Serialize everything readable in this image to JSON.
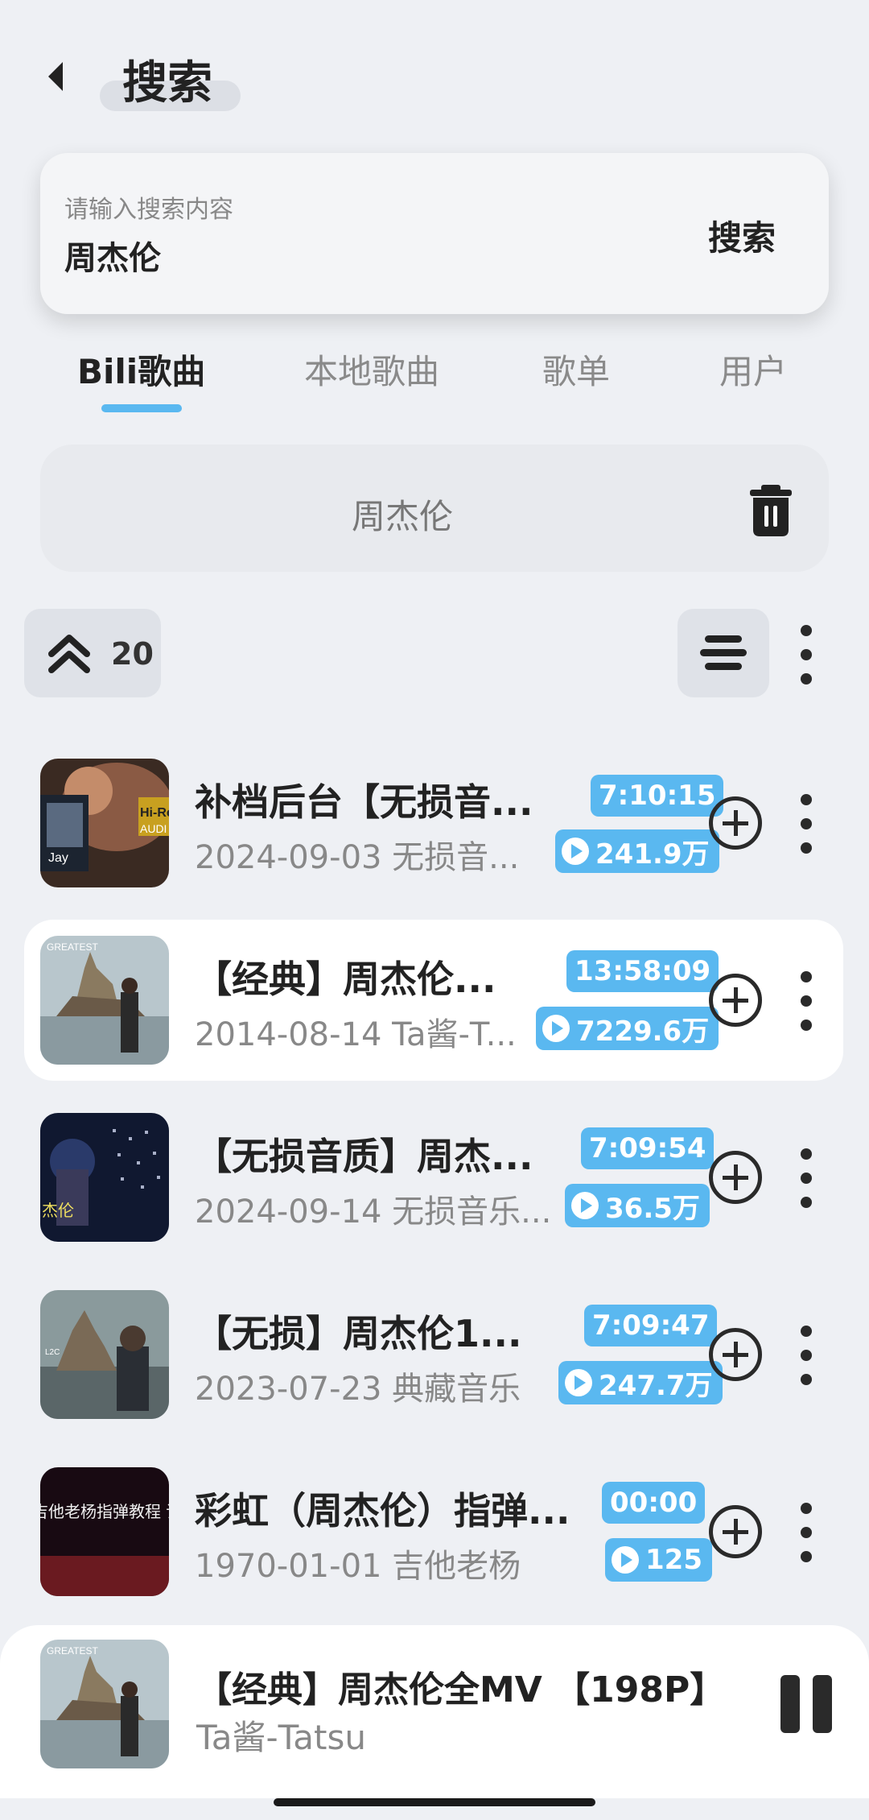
{
  "header": {
    "title": "搜索"
  },
  "search": {
    "placeholder": "请输入搜索内容",
    "value": "周杰伦",
    "button_label": "搜索"
  },
  "tabs": [
    {
      "label": "Bili歌曲",
      "active": true
    },
    {
      "label": "本地歌曲",
      "active": false
    },
    {
      "label": "歌单",
      "active": false
    },
    {
      "label": "用户",
      "active": false
    }
  ],
  "history": {
    "items": [
      "周杰伦"
    ]
  },
  "toolbar": {
    "count": "20"
  },
  "results": [
    {
      "title": "补档后台【无损音...",
      "subtitle": "2024-09-03 无损音...",
      "duration": "7:10:15",
      "plays": "241.9万",
      "thumb_text": "Hi-Res AUDIO",
      "highlighted": false
    },
    {
      "title": "【经典】周杰伦...",
      "subtitle": "2014-08-14 Ta酱-T...",
      "duration": "13:58:09",
      "plays": "7229.6万",
      "thumb_text": "",
      "highlighted": true
    },
    {
      "title": "【无损音质】周杰...",
      "subtitle": "2024-09-14 无损音乐...",
      "duration": "7:09:54",
      "plays": "36.5万",
      "thumb_text": "杰伦",
      "highlighted": false
    },
    {
      "title": "【无损】周杰伦1...",
      "subtitle": "2023-07-23 典藏音乐",
      "duration": "7:09:47",
      "plays": "247.7万",
      "thumb_text": "",
      "highlighted": false
    },
    {
      "title": "彩虹（周杰伦）指弹...",
      "subtitle": "1970-01-01 吉他老杨",
      "duration": "00:00",
      "plays": "125",
      "thumb_text": "吉他老杨指弹教程 详细讲解及曲谱",
      "highlighted": false
    }
  ],
  "player": {
    "title": "【经典】周杰伦全MV 【198P】",
    "artist": "Ta酱-Tatsu"
  },
  "colors": {
    "accent": "#5ab8f0",
    "background": "#eef0f4",
    "text": "#222222"
  }
}
